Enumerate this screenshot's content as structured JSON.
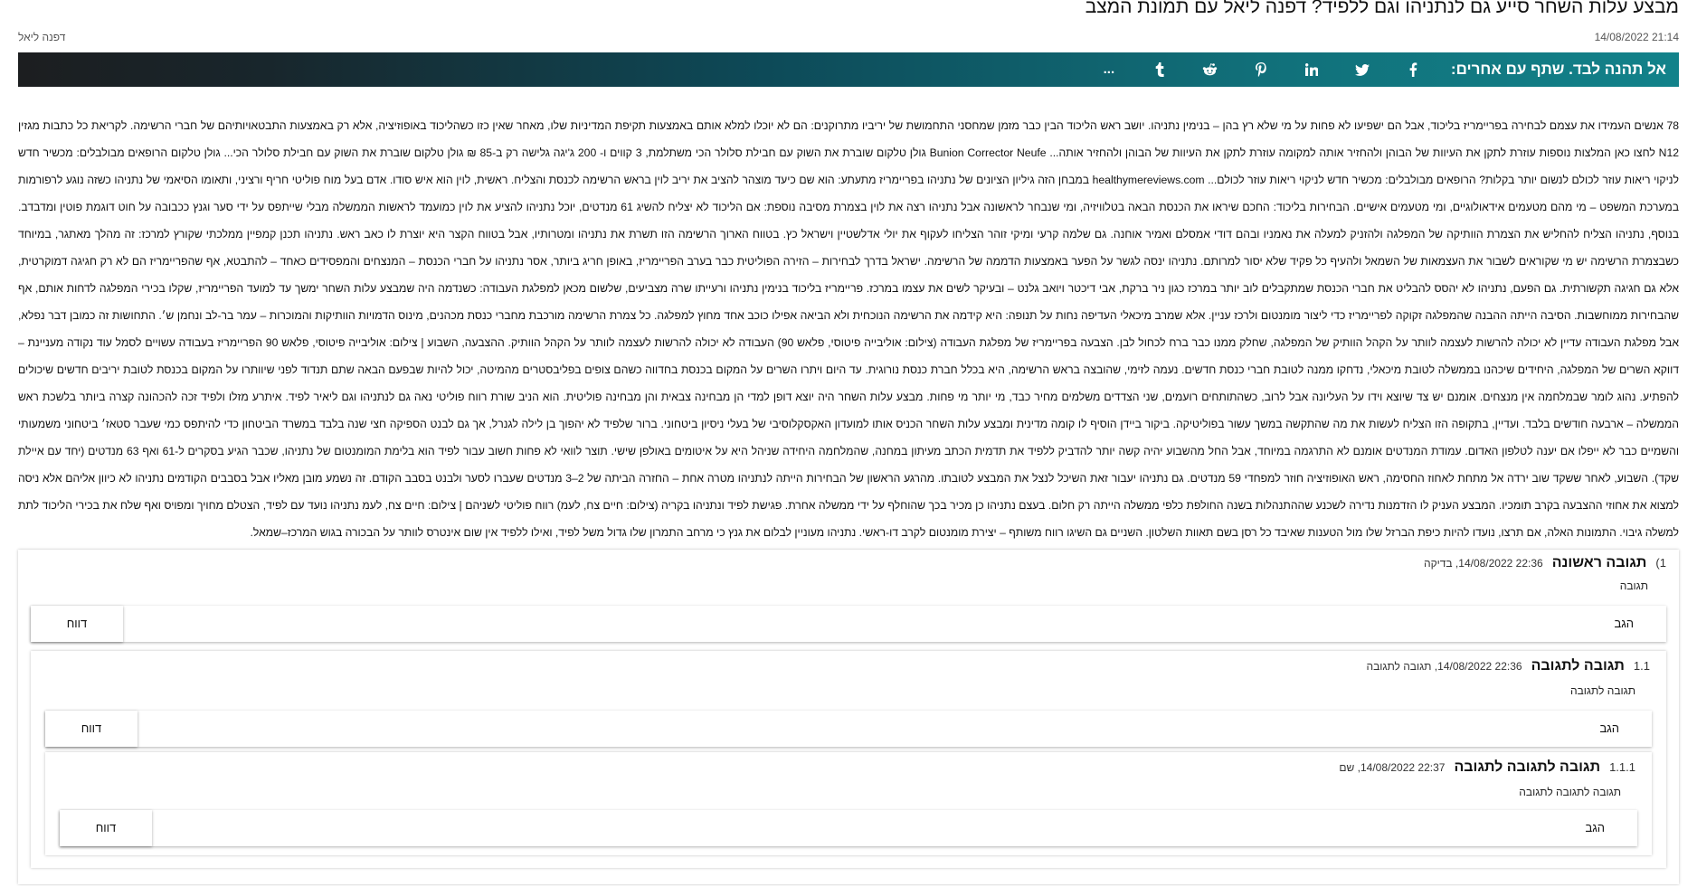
{
  "article": {
    "title": "מבצע עלות השחר סייע גם לנתניהו וגם ללפיד? דפנה ליאל עם תמונת המצב",
    "datetime": "21:14 14/08/2022",
    "author": "דפנה ליאל",
    "body": "78 אנשים העמידו את עצמם לבחירה בפריימריז בליכוד, אבל הם ישפיעו לא פחות על מי שלא רץ בהן – בנימין נתניהו. יושב ראש הליכוד הבין כבר מזמן שמחסני התחמושת של יריביו מתרוקנים: הם לא יוכלו למלא אותם באמצעות תקיפת המדיניות שלו, מאחר שאין כזו כשהליכוד באופוזיציה, אלא רק באמצעות התבטאויותיהם של חברי הרשימה. לקריאת כל כתבות מגזין N12 לחצו כאן המלצות נוספות עוזרת לתקן את העיוות של הבוהן ולהחזיר אותה למקומה עוזרת לתקן את העיוות של הבוהן ולהחזיר אותה... Bunion Corrector Neufe גולן טלקום שוברת את השוק עם חבילת סלולר הכי משתלמת, 3 קווים ו- 200 ג'יגה גלישה רק ב-85 ₪ גולן טלקום שוברת את השוק עם חבילת סלולר הכי... גולן טלקום הרופאים מבולבלים: מכשיר חדש לניקוי ריאות עוזר לכולם לנשום יותר בקלות? הרופאים מבולבלים: מכשיר חדש לניקוי ריאות עוזר לכולם... healthymereviews.com במבחן הזה גיליון הציונים של נתניהו בפריימריז מתעתע: הוא שם כיעד מוצהר להציב את יריב לוין בראש הרשימה לכנסת והצליח. ראשית, לוין הוא איש סודו. אדם בעל מוח פוליטי חריף ורציני, ותאומו הסיאמי של נתניהו כשזה נוגע לרפורמות במערכת המשפט – מי מהם מטעמים אידאולוגיים, ומי מטעמים אישיים. הבחירות בליכוד: החכם שיראו את הכנסת הבאה בטלוויזיה, ומי שנבחר לראשונה אבל נתניהו רצה את לוין בצמרת מסיבה נוספת: אם הליכוד לא יצליח להשיג 61 מנדטים, יוכל נתניהו להציע את לוין כמועמד לראשות הממשלה מבלי שייתפס על ידי סער וגנץ ככבובה על חוט דוגמת פוטין ומדבדב. בנוסף, נתניהו הצליח להחליש את הצמרת הוותיקה של המפלגה ולהזניק למעלה את נאמניו ובהם דודי אמסלם ואמיר אוחנה. גם שלמה קרעי ומיקי זוהר הצליחו לעקוף את יולי אדלשטיין וישראל כץ. בטווח הארוך הרשימה הזו תשרת את נתניהו ומטרותיו, אבל בטווח הקצר היא יוצרת לו כאב ראש. נתניהו תכנן קמפיין ממלכתי שקורץ למרכז: זה מהלך מאתגר, במיוחד כשבצמרת הרשימה יש מי שקוראים לשבור את העצמאות של השמאל ולהעיף כל פקיד שלא יסור למרותם. נתניהו ינסה לגשר על הפער באמצעות הדממה של הרשימה. ישראל בדרך לבחירות – הזירה הפוליטית כבר בערב הפריימריז, באופן חריג ביותר, אסר נתניהו על חברי הכנסת – המנצחים והמפסידים כאחד – להתבטא, אף שהפריימריז הם לא רק חגיגה דמוקרטית, אלא גם חגיגה תקשורתית. גם הפעם, נתניהו לא יהסס להבליט את חברי הכנסת שמתקבלים לוב יותר במרכז כגון ניר ברקת, אבי דיכטר ויואב גלנט – ובעיקר לשים את עצמו במרכז. פריימריז בליכוד בנימין נתניהו ורעייתו שרה מצביעים, שלשום מכאן למפלגת העבודה: כשנדמה היה שמבצע עלות השחר ימשך עד למועד הפריימריז, שקלו בכירי המפלגה לדחות אותם, אף שהבחירות ממוחשבות. הסיבה הייתה ההבנה שהמפלגה זקוקה לפריימריז כדי ליצור מומנטום ולרכז עניין. אלא שמרב מיכאלי העדיפה נחות על תנופה: היא קידמה את הרשימה הנוכחית ולא הביאה אפילו כוכב אחד מחוץ למפלגה. כל צמרת הרשימה מורכבת מחברי כנסת מכהנים, מינוס הדמויות הוותיקות והמוכרות – עמר בר-לב ונחמן ש׳. התחושות זה כמובן דבר נפלא, אבל מפלגת העבודה עדיין לא יכולה להרשות לעצמה לוותר על הקהל הוותיק של המפלגה, שחלק ממנו כבר ברח לכחול לבן. הצבעה בפריימריז של מפלגת העבודה (צילום: אוליבייה פיטוסי, פלאש 90) העבודה לא יכולה להרשות לעצמה לוותר על הקהל הוותיק. ההצבעה, השבוע | צילום: אוליבייה פיטוסי, פלאש 90 הפריימריז בעבודה עשויים לסמל עוד נקודה מעניינת – דווקא השרים של המפלגה, היחידים שיכהנו בממשלה לטובת מיכאלי, נדחקו ממנה לטובת חברי כנסת חדשים. נעמה לזימי, שהובצה בראש הרשימה, היא בכלל חברת כנסת נורוגית. עד היום ויתרו השרים על המקום בכנסת בחדווה כשהם צופים בפליבסטרים מהמיטה, יכול להיות שבפעם הבאה שתם תנדוד לפני שיוותרו על המקום בכנסת לטובת יריבים חדשים שיכולים להפתיע. נהוג לומר שבמלחמה אין מנצחים. אומנם יש צד שיוצא וידו על העליונה אבל לרוב, כשהתותחים רועמים, שני הצדדים משלמים מחיר כבד, מי יותר מי פחות. מבצע עלות השחר היה יוצא דופן למדי הן מבחינה צבאית והן מבחינה פוליטית. הוא הניב שורת רווח פוליטי נאה גם לנתניהו וגם ליאיר לפיד. איתרע מזלו ולפיד זכה להכהונה קצרה ביותר בלשכת ראש הממשלה – ארבעה חודשים בלבד. ועדיין, בתקופה הזו הצליח לעשות את מה שהתקשה במשך עשור בפוליטיקה. ביקור ביידן הוסיף לו קומה מדינית ומבצע עלות השחר הכניס אותו למועדון האקסקלוסיבי של בעלי ניסיון ביטחוני. ברור שלפיד לא יהפוך בן לילה לגנרל, אך גם לבנט הספיקה חצי שנה בלבד במשרד הביטחון כדי להיתפס כמי שעבר סטאז׳ ביטחוני משמעותי והשמיים כבר לא ייפלו אם יענה לטלפון האדום. עמודת המנדטים אומנם לא התרגמה במיוחד, אבל החל מהשבוע יהיה קשה יותר להדביק ללפיד את תדמית הכתב מעיתון במחנה, שהמלחמה היחידה שניהל היא על איטומים באולפן שישי. תוצר לוואי לא פחות חשוב עבור לפיד הוא בלימת המומנטום של נתניהו, שכבר הגיע בסקרים ל-61 ואף 63 מנדטים (יחד עם איילת שקד). השבוע, לאחר ששקד שוב ירדה אל מתחת לאחוז החסימה, ראש האופוזיציה חוזר למפחדי 59 מנדטים. גם נתניהו יעבור זאת השיכל לנצל את המבצע לטובתו. מהרגע הראשון של הבחירות הייתה לנתניהו מטרה אחת – החזרה הביתה של 2–3 מנדטים שעברו לסער ולבנט בסבב הקודם. זה נשמע מובן מאליו אבל בסבבים הקודמים נתניהו לא כיוון אליהם אלא ניסה למצוא את אחוזי ההצבעה בקרב תומכיו. המבצע העניק לו הזדמנות נדירה לשכנע שההתנהלות בשנה החולפת כלפי ממשלה הייתה רק חלום. בעצם נתניהו כן מכיר בכך שהוחלף על ידי ממשלה אחרת. פגישת לפיד ונתניהו בקריה (צילום: חיים צח, לעמ) רווח פוליטי לשניהם | צילום: חיים צח, לעמ נתניהו נועד עם לפיד, הצטלם מחויך ומפויס ואף שלח את בכירי הליכוד לתת למשלה גיבוי. התמונות האלה, אם תרצו, נועדו להיות כיפת הברזל שלו מול הטענות שאיבד כל רסן בשם תאוות השלטון. השניים גם השיגו רווח משותף – יצירת מומנטום לקרב דו-ראשי. נתניהו מעוניין לבלום את גנץ כי מרחב התמרון שלו גדול משל לפיד, ואילו ללפיד אין שום אינטרס לוותר על הבכורה בגוש המרכז–שמאל."
  },
  "share": {
    "label": "אל תהנה לבד. שתף עם אחרים:",
    "icons": [
      "facebook-icon",
      "twitter-icon",
      "linkedin-icon",
      "pinterest-icon",
      "reddit-icon",
      "tumblr-icon",
      "more-icon"
    ],
    "more_label": "..."
  },
  "comments": [
    {
      "number": "1)",
      "title": "תגובה ראשונה",
      "meta": "22:36 14/08/2022, בדיקה",
      "text": "תגובה",
      "reply_label": "הגב",
      "report_label": "דווח"
    },
    {
      "number": "1.1",
      "title": "תגובה לתגובה",
      "meta": "22:36 14/08/2022, תגובה לתגובה",
      "text": "תגובה לתגובה",
      "reply_label": "הגב",
      "report_label": "דווח"
    },
    {
      "number": "1.1.1",
      "title": "תגובה לתגובה לתגובה",
      "meta": "22:37 14/08/2022, שם",
      "text": "תגובה לתגובה לתגובה",
      "reply_label": "הגב",
      "report_label": "דווח"
    }
  ]
}
